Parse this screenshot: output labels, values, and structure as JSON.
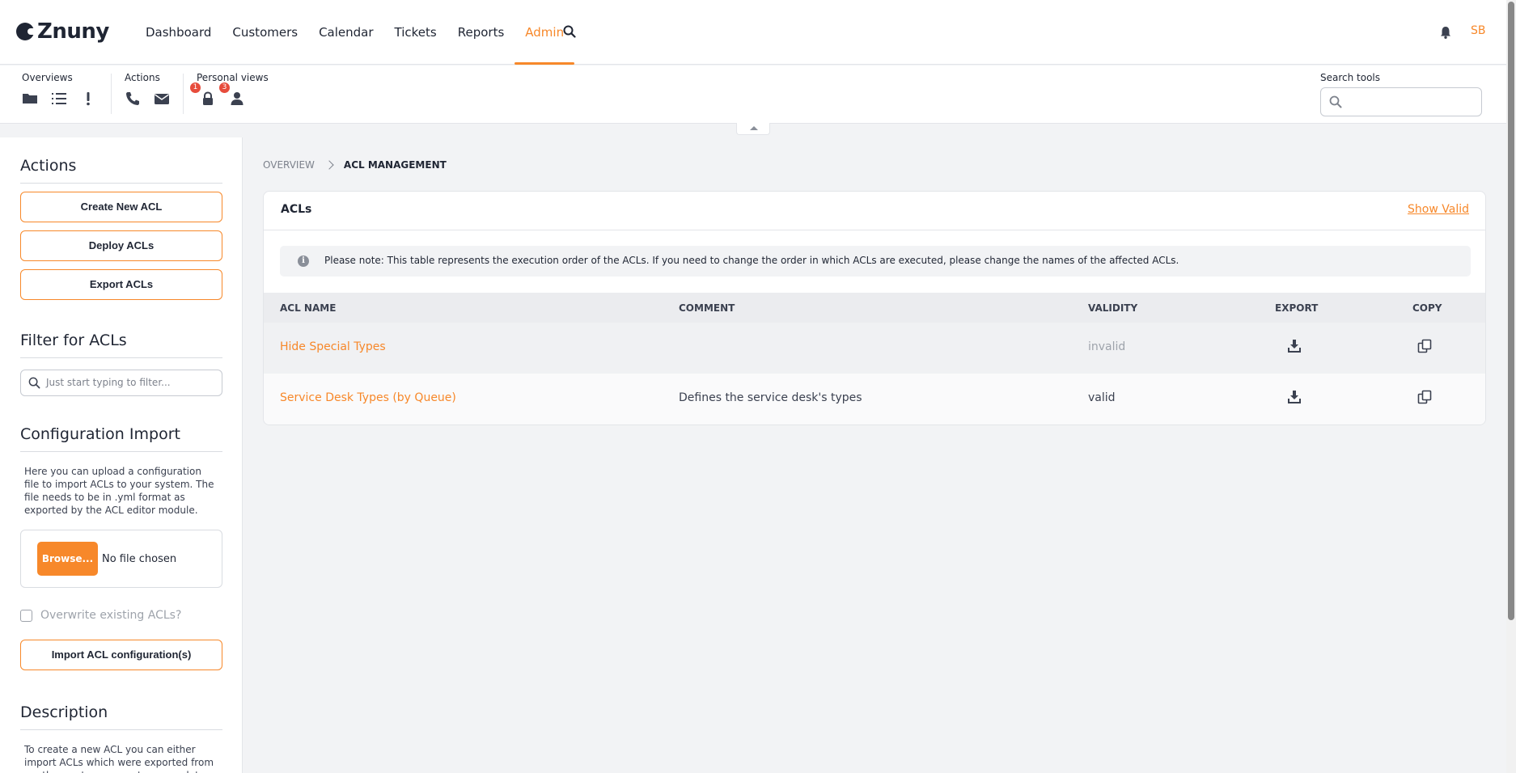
{
  "brand": {
    "name": "Znuny"
  },
  "nav": {
    "items": [
      {
        "label": "Dashboard"
      },
      {
        "label": "Customers"
      },
      {
        "label": "Calendar"
      },
      {
        "label": "Tickets"
      },
      {
        "label": "Reports"
      },
      {
        "label": "Admin",
        "active": true
      }
    ],
    "search_icon": "search-icon",
    "notification_icon": "bell-icon",
    "user_initials": "SB"
  },
  "toolbar": {
    "overviews": {
      "title": "Overviews",
      "icons": [
        "folder-icon",
        "list-icon",
        "exclamation-icon"
      ]
    },
    "actions": {
      "title": "Actions",
      "icons": [
        "phone-icon",
        "envelope-icon"
      ]
    },
    "personal_views": {
      "title": "Personal views",
      "locked_count": "1",
      "owned_count": "3"
    },
    "search_tools": {
      "label": "Search tools",
      "placeholder": ""
    }
  },
  "sidebar": {
    "actions": {
      "title": "Actions",
      "buttons": [
        "Create New ACL",
        "Deploy ACLs",
        "Export ACLs"
      ]
    },
    "filter": {
      "title": "Filter for ACLs",
      "placeholder": "Just start typing to filter..."
    },
    "import": {
      "title": "Configuration Import",
      "text": "Here you can upload a configuration file to import ACLs to your system. The file needs to be in .yml format as exported by the ACL editor module.",
      "browse_label": "Browse...",
      "file_status": "No file chosen",
      "overwrite_label": "Overwrite existing ACLs?",
      "overwrite_checked": false,
      "import_button": "Import ACL configuration(s)"
    },
    "description": {
      "title": "Description",
      "text": "To create a new ACL you can either import ACLs which were exported from another system or create a complete new one."
    }
  },
  "breadcrumb": {
    "items": [
      "Overview"
    ],
    "current": "ACL Management"
  },
  "panel": {
    "title": "ACLs",
    "show_valid": "Show Valid",
    "notice": "Please note: This table represents the execution order of the ACLs. If you need to change the order in which ACLs are executed, please change the names of the affected ACLs.",
    "columns": [
      "ACL Name",
      "Comment",
      "Validity",
      "Export",
      "Copy"
    ],
    "rows": [
      {
        "name": "Hide Special Types",
        "comment": "",
        "validity": "invalid"
      },
      {
        "name": "Service Desk Types (by Queue)",
        "comment": "Defines the service desk's types",
        "validity": "valid"
      }
    ]
  },
  "colors": {
    "accent": "#f7882a",
    "text": "#1f2533",
    "badge": "#e74c3c"
  }
}
